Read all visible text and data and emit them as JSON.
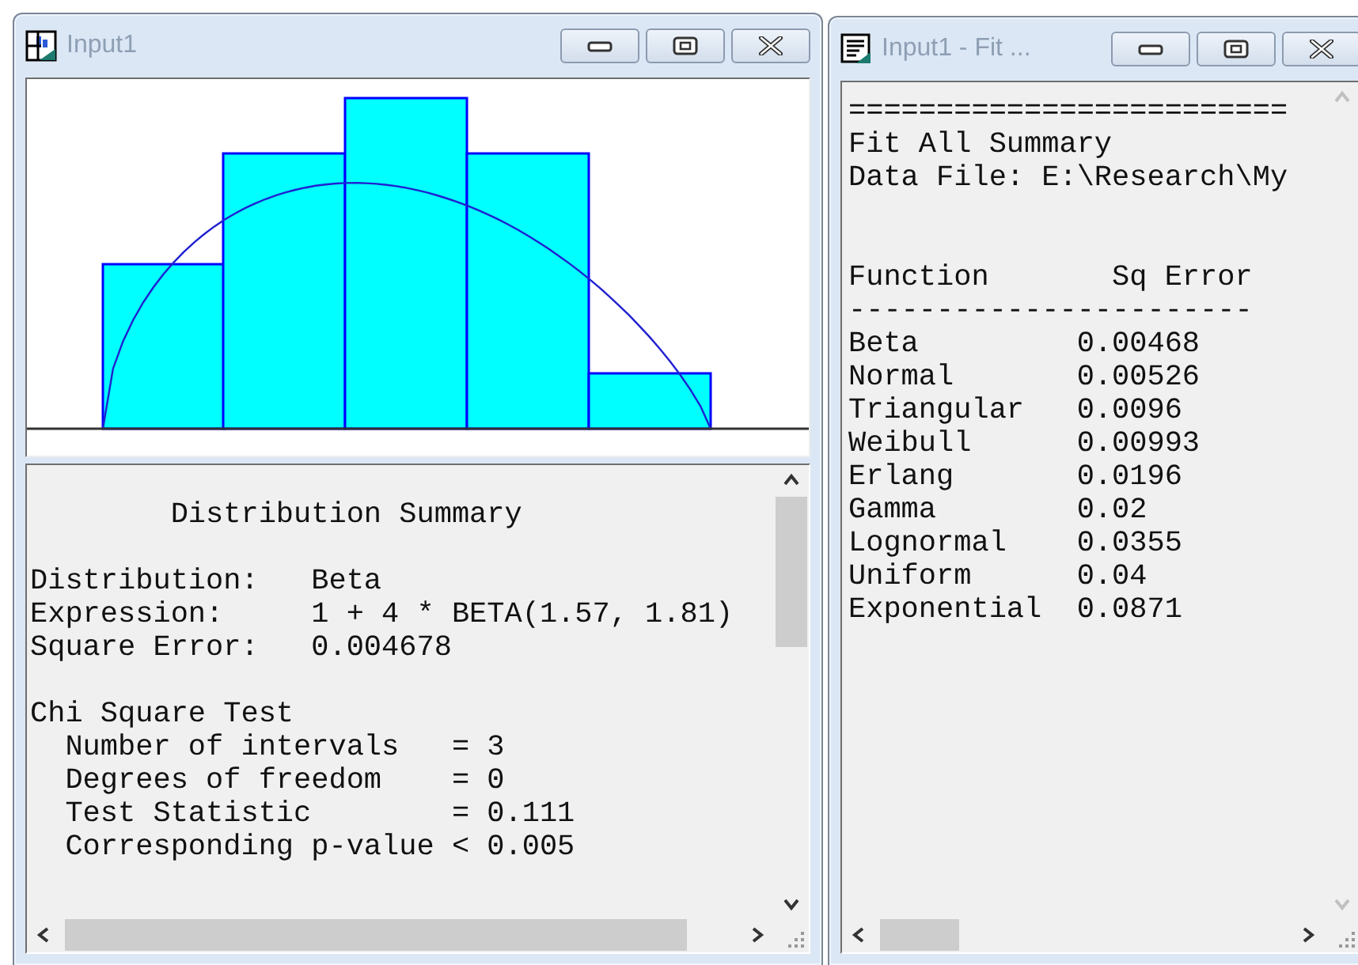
{
  "distribution_window": {
    "title": "Input1",
    "summary": {
      "heading": "Distribution Summary",
      "fields": [
        {
          "label": "Distribution:",
          "value": "Beta"
        },
        {
          "label": "Expression:",
          "value": "1 + 4 * BETA(1.57, 1.81)"
        },
        {
          "label": "Square Error:",
          "value": "0.004678"
        }
      ],
      "test": {
        "heading": "Chi Square Test",
        "items": [
          {
            "label": "Number of intervals",
            "value": "= 3"
          },
          {
            "label": "Degrees of freedom",
            "value": "= 0"
          },
          {
            "label": "Test Statistic",
            "value": "= 0.111"
          },
          {
            "label": "Corresponding p-value",
            "value": "< 0.005"
          }
        ]
      }
    }
  },
  "fit_window": {
    "title": "Input1 - Fit ...",
    "rule": "=========================",
    "heading": "Fit All Summary",
    "data_file": "Data File: E:\\Research\\My",
    "columns": [
      "Function",
      "Sq Error"
    ],
    "divider": "-----------------------",
    "rows": [
      {
        "function": "Beta",
        "sq_error": "0.00468"
      },
      {
        "function": "Normal",
        "sq_error": "0.00526"
      },
      {
        "function": "Triangular",
        "sq_error": "0.0096"
      },
      {
        "function": "Weibull",
        "sq_error": "0.00993"
      },
      {
        "function": "Erlang",
        "sq_error": "0.0196"
      },
      {
        "function": "Gamma",
        "sq_error": "0.02"
      },
      {
        "function": "Lognormal",
        "sq_error": "0.0355"
      },
      {
        "function": "Uniform",
        "sq_error": "0.04"
      },
      {
        "function": "Exponential",
        "sq_error": "0.0871"
      }
    ]
  }
}
